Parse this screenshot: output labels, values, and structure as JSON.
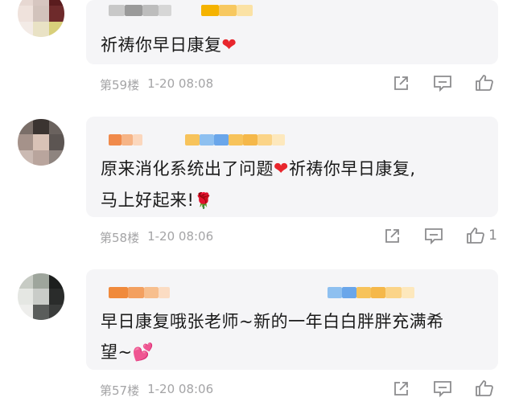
{
  "comments": [
    {
      "text": "祈祷你早日康复",
      "heart_icon": "heart-icon",
      "floor": "第59楼",
      "time": "1-20 08:08",
      "like_count": ""
    },
    {
      "text_line1": "原来消化系统出了问题",
      "text_line1_after": "祈祷你早日康复,",
      "text_line2": "马上好起来!",
      "floor": "第58楼",
      "time": "1-20 08:06",
      "like_count": "1"
    },
    {
      "text_line1": "早日康复哦张老师~新的一年白白胖胖充满希",
      "text_line2": "望~",
      "floor": "第57楼",
      "time": "1-20 08:06",
      "like_count": ""
    }
  ],
  "colors": {
    "bubble_bg": "#f5f5f7",
    "meta_text": "#a4a4a6",
    "heart": "#e8262d"
  }
}
